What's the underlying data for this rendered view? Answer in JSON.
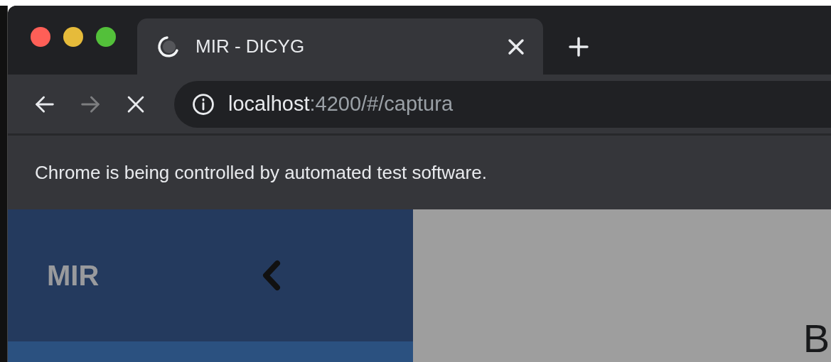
{
  "tab": {
    "title": "MIR - DICYG",
    "loading": true
  },
  "navigation": [
    {
      "kind": "back",
      "disabled": false
    },
    {
      "kind": "forward",
      "disabled": true
    },
    {
      "kind": "stop",
      "disabled": false
    }
  ],
  "address": {
    "host": "localhost",
    "path": ":4200/#/captura"
  },
  "infobar": "Chrome is being controlled by automated test software.",
  "sidebar": {
    "brand": "MIR"
  },
  "main": {
    "heading": "B"
  }
}
